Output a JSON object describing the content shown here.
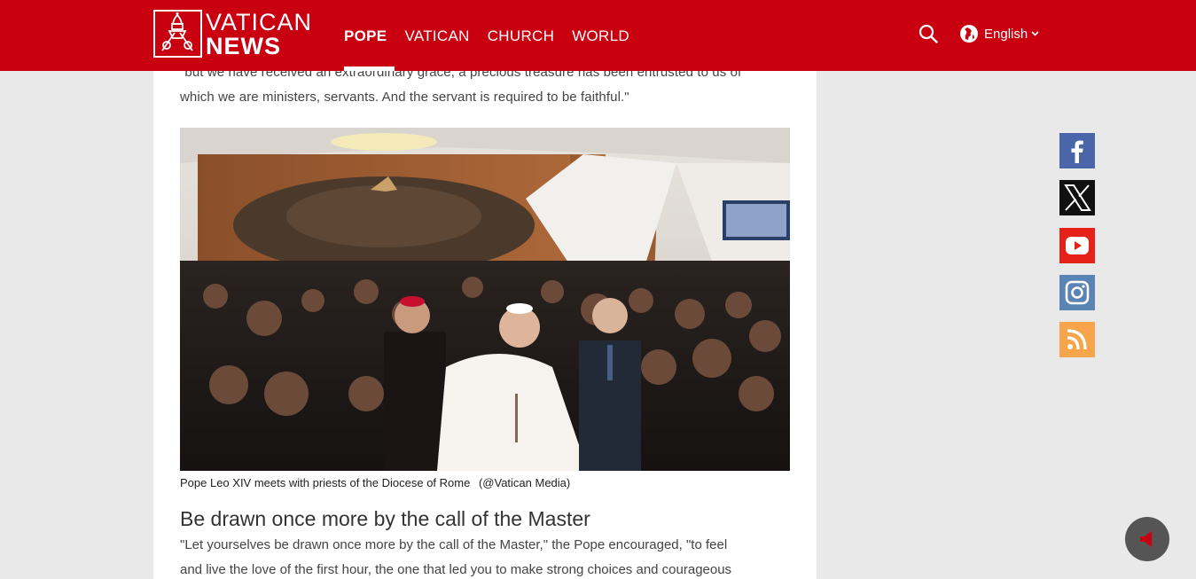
{
  "header": {
    "logo_top": "VATICAN",
    "logo_bottom": "NEWS",
    "nav": [
      "POPE",
      "VATICAN",
      "CHURCH",
      "WORLD"
    ],
    "active_nav": "POPE",
    "language": "English",
    "brand_color": "#c8000f"
  },
  "article": {
    "quote_line_1": "\"but we have received an extraordinary grace, a precious treasure has been entrusted to us of",
    "quote_line_2": "which we are ministers, servants. And the servant is required to be faithful.\"",
    "photo_caption": "Pope Leo XIV meets with priests of the Diocese of Rome",
    "photo_credit": "(@Vatican Media)",
    "subheading": "Be drawn once more by the call of the Master",
    "para_line_1": "\"Let yourselves be drawn once more by the call of the Master,\" the Pope encouraged, \"to feel",
    "para_line_2": "and live the love of the first hour, the one that led you to make strong choices and courageous"
  },
  "social": {
    "icons": [
      "facebook-icon",
      "x-icon",
      "youtube-icon",
      "instagram-icon",
      "rss-icon"
    ],
    "colors": [
      "#4a66a8",
      "#111111",
      "#e62117",
      "#5a84b3",
      "#f7a54a"
    ]
  },
  "audio": {
    "icon": "speaker-icon",
    "accent": "#c8000f"
  }
}
